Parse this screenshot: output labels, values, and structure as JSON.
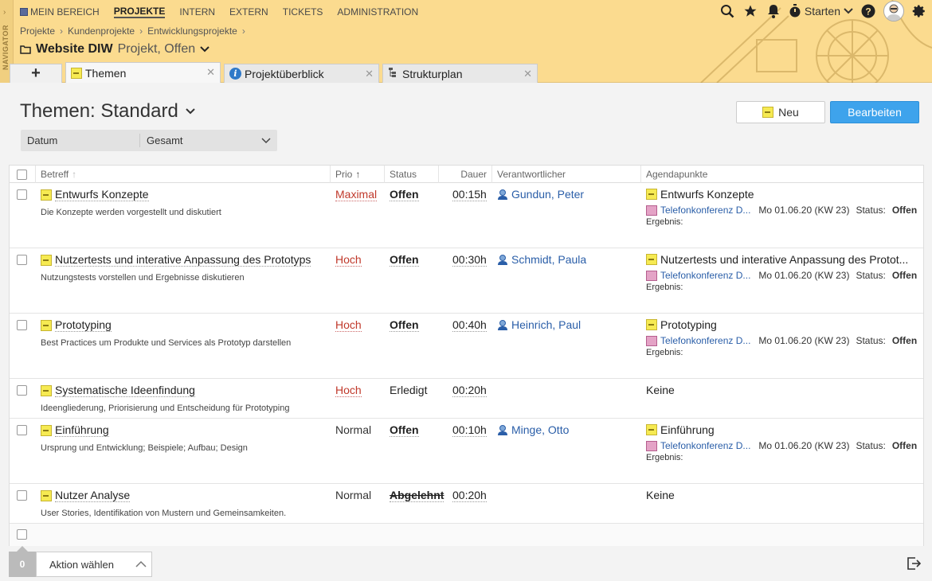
{
  "navigator": {
    "label": "NAVIGATOR"
  },
  "mainnav": {
    "items": [
      {
        "label": "MEIN BEREICH"
      },
      {
        "label": "PROJEKTE"
      },
      {
        "label": "INTERN"
      },
      {
        "label": "EXTERN"
      },
      {
        "label": "TICKETS"
      },
      {
        "label": "ADMINISTRATION"
      }
    ]
  },
  "topright": {
    "starten": "Starten"
  },
  "breadcrumb": [
    "Projekte",
    "Kundenprojekte",
    "Entwicklungsprojekte"
  ],
  "project": {
    "name": "Website DIW",
    "sub": "Projekt, Offen"
  },
  "tabs": [
    {
      "label": "Themen"
    },
    {
      "label": "Projektüberblick"
    },
    {
      "label": "Strukturplan"
    }
  ],
  "page": {
    "title": "Themen: Standard"
  },
  "buttons": {
    "new": "Neu",
    "edit": "Bearbeiten"
  },
  "filter": {
    "field": "Datum",
    "value": "Gesamt"
  },
  "columns": {
    "subject": "Betreff",
    "prio": "Prio",
    "status": "Status",
    "dauer": "Dauer",
    "resp": "Verantwortlicher",
    "agenda": "Agendapunkte"
  },
  "rows": [
    {
      "subject": "Entwurfs Konzepte",
      "desc": "Die Konzepte werden vorgestellt und diskutiert",
      "prio": "Maximal",
      "status": "Offen",
      "dauer": "00:15h",
      "resp": "Gundun, Peter",
      "agenda": {
        "title": "Entwurfs Konzepte",
        "meeting": "Telefonkonferenz D...",
        "date": "Mo 01.06.20 (KW 23)",
        "status_label": "Status:",
        "status": "Offen",
        "ergebnis": "Ergebnis:"
      }
    },
    {
      "subject": "Nutzertests und interative Anpassung des Prototyps",
      "desc": "Nutzungstests vorstellen und Ergebnisse diskutieren",
      "prio": "Hoch",
      "status": "Offen",
      "dauer": "00:30h",
      "resp": "Schmidt, Paula",
      "agenda": {
        "title": "Nutzertests und interative Anpassung des Protot...",
        "meeting": "Telefonkonferenz D...",
        "date": "Mo 01.06.20 (KW 23)",
        "status_label": "Status:",
        "status": "Offen",
        "ergebnis": "Ergebnis:"
      }
    },
    {
      "subject": "Prototyping",
      "desc": "Best Practices um Produkte und Services als Prototyp darstellen",
      "prio": "Hoch",
      "status": "Offen",
      "dauer": "00:40h",
      "resp": "Heinrich, Paul",
      "agenda": {
        "title": "Prototyping",
        "meeting": "Telefonkonferenz D...",
        "date": "Mo 01.06.20 (KW 23)",
        "status_label": "Status:",
        "status": "Offen",
        "ergebnis": "Ergebnis:"
      }
    },
    {
      "subject": "Systematische Ideenfindung",
      "desc": "Ideengliederung, Priorisierung und Entscheidung für Prototyping",
      "prio": "Hoch",
      "status": "Erledigt",
      "dauer": "00:20h",
      "resp": "",
      "agenda_none": "Keine"
    },
    {
      "subject": "Einführung",
      "desc": "Ursprung und Entwicklung; Beispiele; Aufbau; Design",
      "prio": "Normal",
      "status": "Offen",
      "dauer": "00:10h",
      "resp": "Minge, Otto",
      "agenda": {
        "title": "Einführung",
        "meeting": "Telefonkonferenz D...",
        "date": "Mo 01.06.20 (KW 23)",
        "status_label": "Status:",
        "status": "Offen",
        "ergebnis": "Ergebnis:"
      }
    },
    {
      "subject": "Nutzer Analyse",
      "desc": "User Stories, Identifikation von Mustern und Gemeinsamkeiten.",
      "prio": "Normal",
      "status": "Abgelehnt",
      "dauer": "00:20h",
      "resp": "",
      "agenda_none": "Keine"
    }
  ],
  "footer": {
    "count": "0",
    "action": "Aktion wählen"
  },
  "colors": {
    "header_bg": "#fbdb8f",
    "accent": "#3ea3ec",
    "prio_high": "#c0392b",
    "link": "#2a5ea8"
  }
}
